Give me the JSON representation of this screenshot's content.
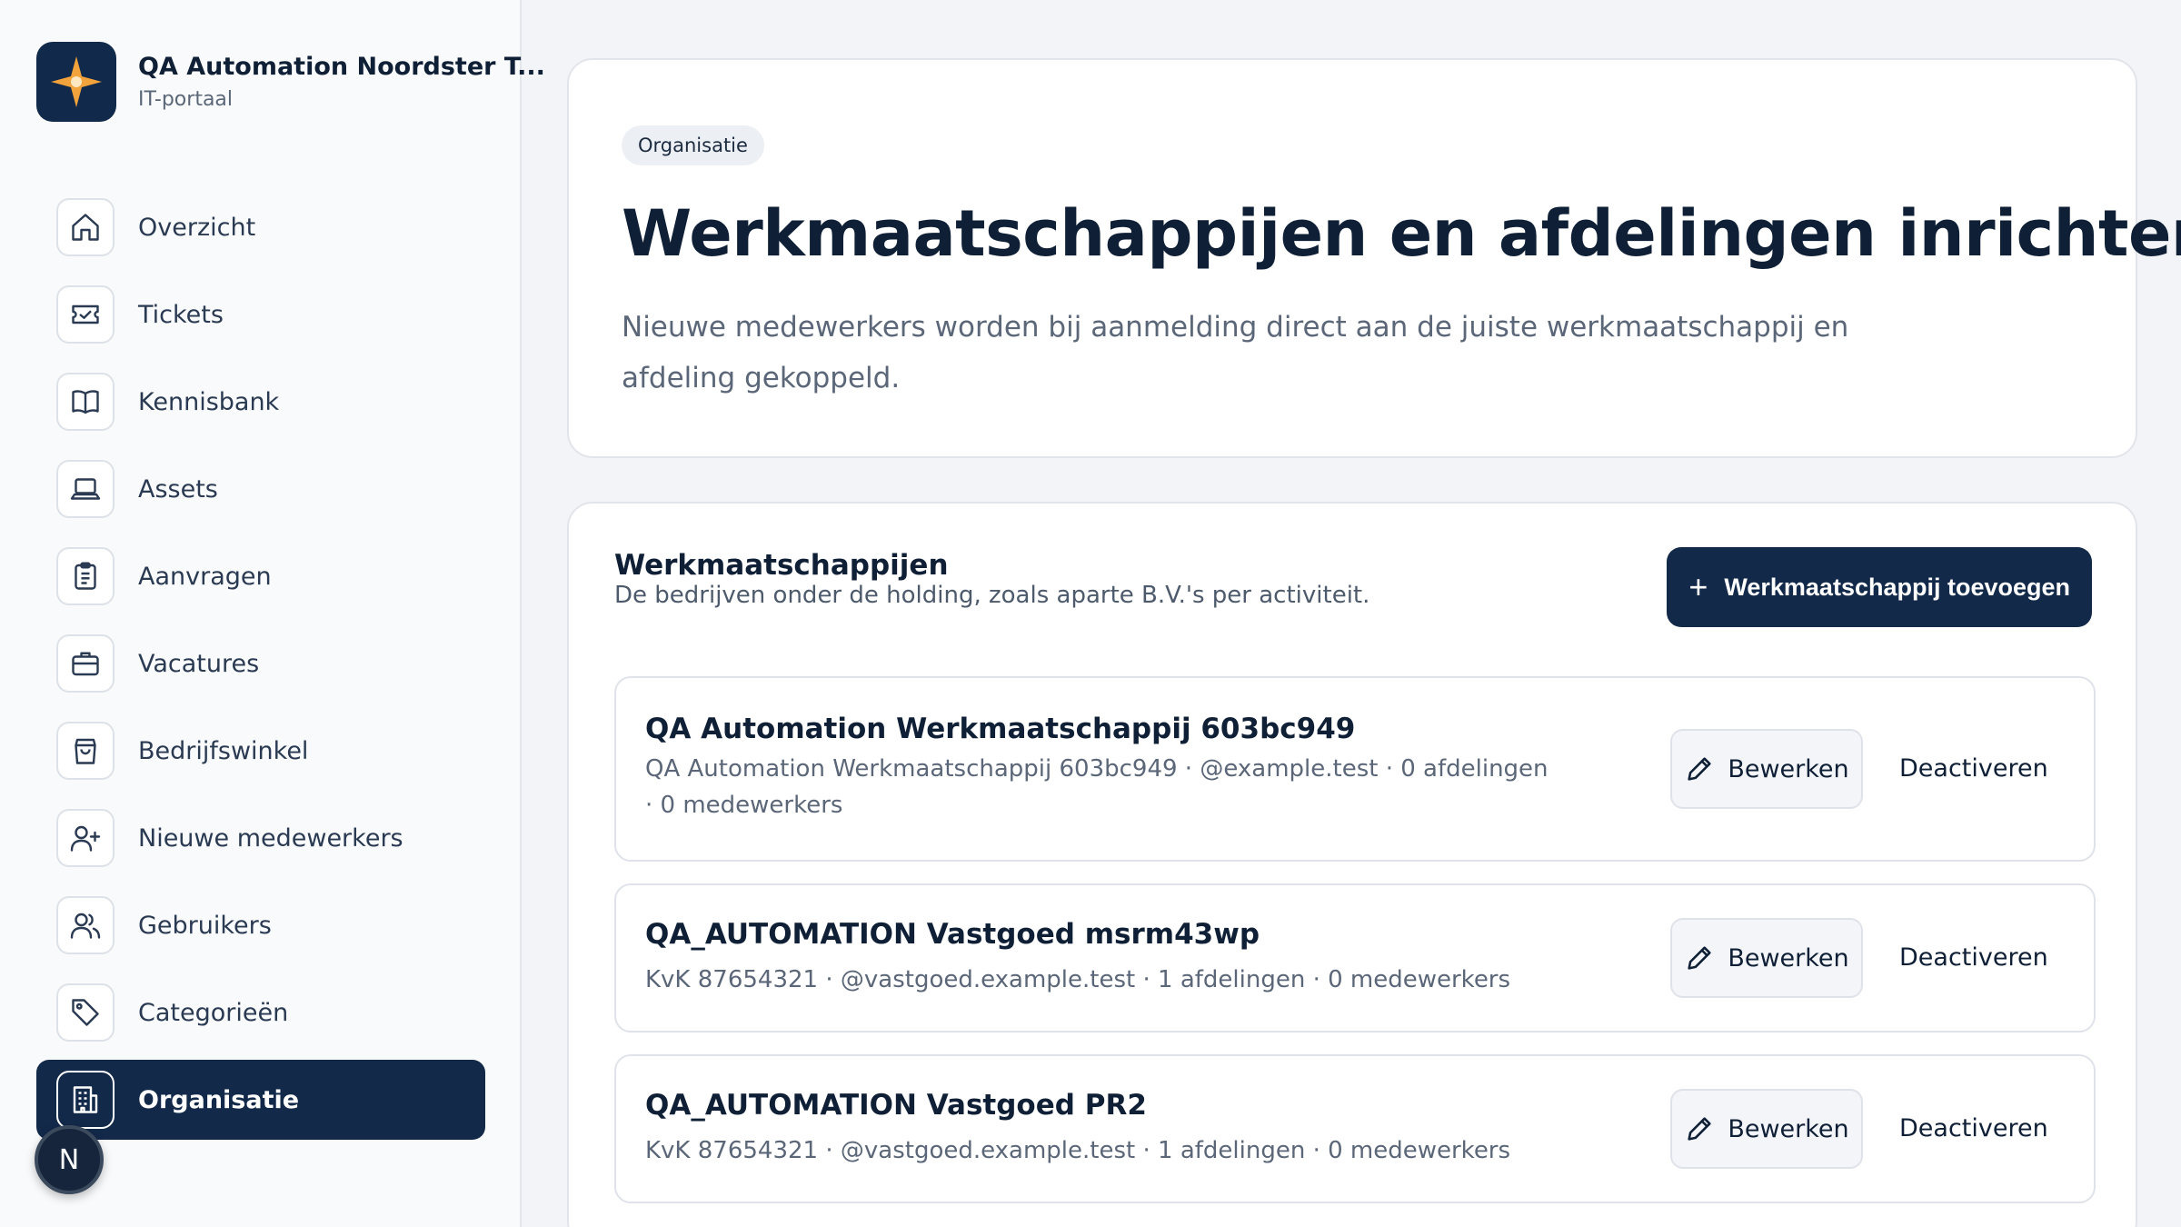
{
  "brand": {
    "title": "QA Automation Noordster T...",
    "subtitle": "IT-portaal",
    "logo_icon": "compass-star-icon",
    "accent": "#f3a33c"
  },
  "nav": {
    "items": [
      {
        "label": "Overzicht",
        "icon": "home-icon"
      },
      {
        "label": "Tickets",
        "icon": "ticket-icon"
      },
      {
        "label": "Kennisbank",
        "icon": "book-icon"
      },
      {
        "label": "Assets",
        "icon": "laptop-icon"
      },
      {
        "label": "Aanvragen",
        "icon": "clipboard-icon"
      },
      {
        "label": "Vacatures",
        "icon": "briefcase-icon"
      },
      {
        "label": "Bedrijfswinkel",
        "icon": "shopping-bag-icon"
      },
      {
        "label": "Nieuwe medewerkers",
        "icon": "user-plus-icon"
      },
      {
        "label": "Gebruikers",
        "icon": "users-icon"
      },
      {
        "label": "Categorieën",
        "icon": "tag-icon"
      },
      {
        "label": "Organisatie",
        "icon": "building-icon",
        "active": true
      }
    ]
  },
  "user": {
    "initial": "N"
  },
  "hero": {
    "badge": "Organisatie",
    "title": "Werkmaatschappijen en afdelingen inrichten",
    "description": "Nieuwe medewerkers worden bij aanmelding direct aan de juiste werkmaatschappij en afdeling gekoppeld."
  },
  "companies": {
    "title": "Werkmaatschappijen",
    "subtitle": "De bedrijven onder de holding, zoals aparte B.V.'s per activiteit.",
    "add_label": "Werkmaatschappij toevoegen",
    "edit_label": "Bewerken",
    "deactivate_label": "Deactiveren",
    "rows": [
      {
        "name": "QA Automation Werkmaatschappij 603bc949",
        "meta": "QA Automation Werkmaatschappij 603bc949 · @example.test · 0 afdelingen · 0 medewerkers"
      },
      {
        "name": "QA_AUTOMATION Vastgoed msrm43wp",
        "meta": "KvK 87654321 · @vastgoed.example.test · 1 afdelingen · 0 medewerkers"
      },
      {
        "name": "QA_AUTOMATION Vastgoed PR2",
        "meta": "KvK 87654321 · @vastgoed.example.test · 1 afdelingen · 0 medewerkers"
      }
    ]
  },
  "colors": {
    "primary": "#13294a",
    "background": "#f2f4f7"
  }
}
